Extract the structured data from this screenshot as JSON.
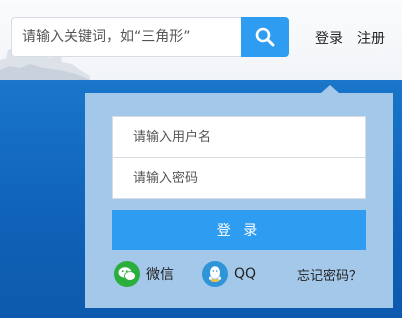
{
  "search": {
    "placeholder": "请输入关键词，如“三角形”",
    "button_icon": "search-icon"
  },
  "header_links": {
    "login": "登录",
    "register": "注册"
  },
  "login_form": {
    "username_placeholder": "请输入用户名",
    "password_placeholder": "请输入密码",
    "submit_label": "登 录",
    "social": [
      {
        "label": "微信",
        "icon": "wechat-icon",
        "color": "#2aae3c"
      },
      {
        "label": "QQ",
        "icon": "qq-icon",
        "color": "#2e95d8"
      }
    ],
    "forgot_password": "忘记密码？"
  },
  "colors": {
    "accent": "#2e9cf0",
    "background_blue": "#1270c4",
    "panel": "#a4c8ea"
  }
}
